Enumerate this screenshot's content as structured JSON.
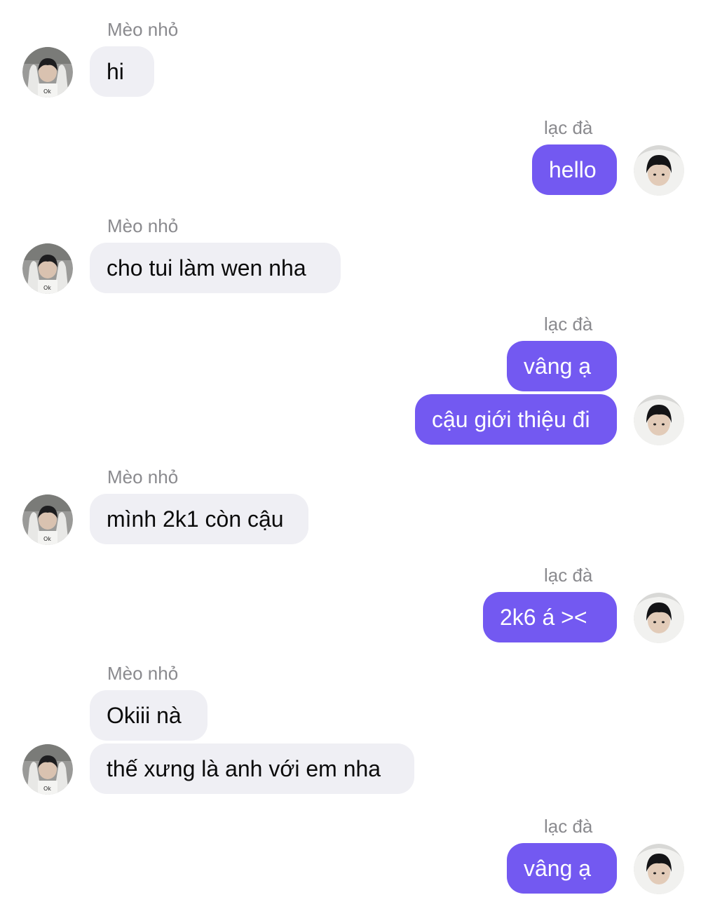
{
  "chat": {
    "contact_name": "Mèo nhỏ",
    "self_name": "lạc đà",
    "messages": [
      {
        "from": "contact",
        "text": "hi"
      },
      {
        "from": "self",
        "text": "hello"
      },
      {
        "from": "contact",
        "text": "cho tui làm wen nha"
      },
      {
        "from": "self",
        "text": "vâng ạ"
      },
      {
        "from": "self",
        "text": "cậu giới thiệu đi"
      },
      {
        "from": "contact",
        "text": "mình 2k1 còn cậu"
      },
      {
        "from": "self",
        "text": "2k6 á ><"
      },
      {
        "from": "contact",
        "text": "Okiii nà"
      },
      {
        "from": "contact",
        "text": "thế xưng là anh với em nha"
      },
      {
        "from": "self",
        "text": "vâng ạ"
      }
    ]
  },
  "colors": {
    "incoming_bubble": "#efeff4",
    "outgoing_bubble": "#7359f1",
    "sender_name": "#8a8a8e"
  },
  "icons": {
    "contact_avatar": "avatar-photo-icon",
    "self_avatar": "avatar-photo-icon"
  }
}
